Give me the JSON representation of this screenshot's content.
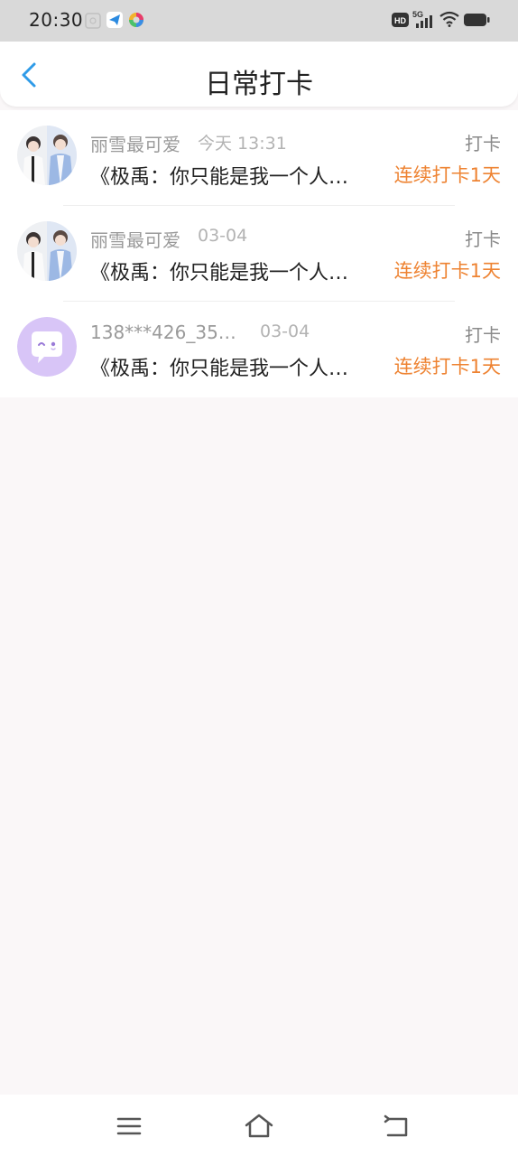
{
  "status_bar": {
    "time": "20:30",
    "network": "5G",
    "hd_badge": "HD",
    "icons": [
      "gallery-icon",
      "telegram-icon",
      "colorful-app-icon",
      "hd-icon",
      "signal-icon",
      "wifi-icon",
      "battery-icon"
    ]
  },
  "header": {
    "title": "日常打卡",
    "back_icon": "chevron-left-icon"
  },
  "colors": {
    "accent_blue": "#2f9be8",
    "streak_orange": "#ee8332",
    "avatar_purple": "#d8c5f7"
  },
  "checkins": [
    {
      "username": "丽雪最可爱",
      "time": "今天 13:31",
      "type": "打卡",
      "book": "《极禹：你只能是我一个人…",
      "streak": "连续打卡1天",
      "avatar": "photo-avatar"
    },
    {
      "username": "丽雪最可爱",
      "time": "03-04",
      "type": "打卡",
      "book": "《极禹：你只能是我一个人…",
      "streak": "连续打卡1天",
      "avatar": "photo-avatar"
    },
    {
      "username": "138***426_35…",
      "time": "03-04",
      "type": "打卡",
      "book": "《极禹：你只能是我一个人…",
      "streak": "连续打卡1天",
      "avatar": "chat-bubble-avatar"
    }
  ],
  "nav_bar": {
    "icons": [
      "menu-icon",
      "home-icon",
      "back-icon"
    ]
  }
}
